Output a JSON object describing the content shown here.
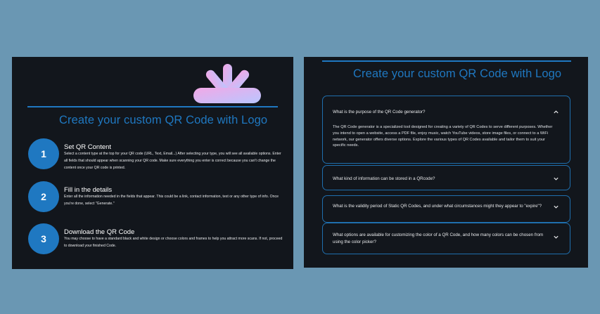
{
  "left": {
    "heading": "Create your custom QR Code with Logo",
    "steps": [
      {
        "number": "1",
        "title": "Set QR Content",
        "description": "Select a content type at the top for your QR code (URL, Text, Email...) After selecting your type, you will see all available options. Enter all fields that should appear when scanning your QR code. Make sure everything you enter is correct because you can't change the content once your QR code is printed."
      },
      {
        "number": "2",
        "title": "Fill in the details",
        "description": "Enter all the information needed in the fields that appear. This could be a link, contact information, text or any other type of info. Once you're done, select \"Generate.\""
      },
      {
        "number": "3",
        "title": "Download the QR Code",
        "description": "You may choose to have a standard black and white design or choose colors and frames to help you attract more scans. If not, proceed to download your finished Code."
      }
    ]
  },
  "right": {
    "heading": "Create your custom QR Code with Logo",
    "faqs": [
      {
        "question": "What is the purpose of the QR Code generator?",
        "answer": "The QR Code generator is a specialized tool designed for creating a variety of QR Codes to serve different purposes. Whether you intend to open a website, access a PDF file, enjoy music, watch YouTube videos, store image files, or connect to a WiFi network, our generator offers diverse options. Explore the various types of QR Codes available and tailor them to suit your specific needs.",
        "expanded": true
      },
      {
        "question": "What kind of information can be stored in a QRcode?",
        "expanded": false
      },
      {
        "question": "What is the validity period of Static QR Codes, and under what circumstances might they appear to \"expire\"?",
        "expanded": false
      },
      {
        "question": "What options are available for customizing the color of a QR Code, and how many colors can be chosen from using the color picker?",
        "expanded": false
      }
    ]
  },
  "colors": {
    "background": "#6a97b3",
    "panel": "#12161c",
    "accent": "#1f78c1",
    "logo_gradient_start": "#f2a8e6",
    "logo_gradient_end": "#b9c6ff"
  },
  "icons": {
    "logo": "burst-logo-icon",
    "expanded": "chevron-up-icon",
    "collapsed": "chevron-down-icon"
  }
}
